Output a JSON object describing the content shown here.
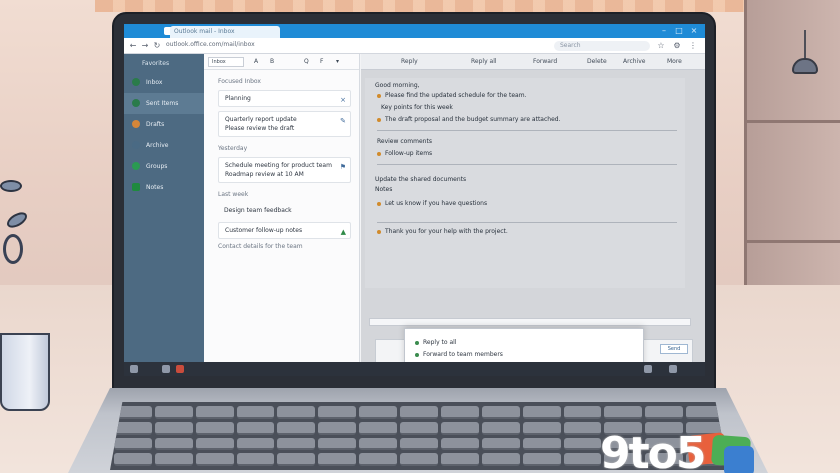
{
  "browser": {
    "tab_title": "Outlook mail - Inbox",
    "url": "outlook.office.com/mail/inbox",
    "search_placeholder": "Search",
    "back_icon": "arrow-left-icon",
    "forward_icon": "arrow-right-icon",
    "refresh_icon": "refresh-icon",
    "controls": [
      "–",
      "□",
      "×"
    ]
  },
  "sidebar": {
    "header": "Favorites",
    "items": [
      {
        "label": "Inbox",
        "color": "#2a7b4a"
      },
      {
        "label": "Sent Items",
        "color": "#2a7b4a"
      },
      {
        "label": "Drafts",
        "color": "#d4863a"
      },
      {
        "label": "Archive",
        "color": "#4a6a84"
      },
      {
        "label": "Groups",
        "color": "#2a9a52"
      },
      {
        "label": "Notes",
        "color": "#1f8a3e"
      }
    ]
  },
  "mail_list": {
    "search_value": "Inbox",
    "toolbar_buttons": [
      "A",
      "B",
      "Q",
      "F",
      "▾"
    ],
    "sections": [
      {
        "header": "Focused Inbox",
        "cards": [
          {
            "line1": "Planning",
            "line2": ""
          },
          {
            "line1": "Quarterly report update",
            "line2": "Please review the draft"
          }
        ]
      },
      {
        "header": "Yesterday",
        "cards": [
          {
            "line1": "Schedule meeting for product team",
            "line2": "Roadmap review at 10 AM"
          }
        ]
      },
      {
        "header": "Last week",
        "cards": [
          {
            "line1": "Design team feedback",
            "line2": ""
          },
          {
            "line1": "Customer follow-up notes",
            "line2": ""
          }
        ]
      }
    ],
    "footer": "Contact details for the team"
  },
  "reading": {
    "toolbar": [
      "Reply",
      "Reply all",
      "Forward",
      "Delete",
      "Archive",
      "More"
    ],
    "lines": [
      "Good morning,",
      "Please find the updated schedule for the team.",
      "Key points for this week",
      "The draft proposal and the budget summary are attached.",
      "Review comments",
      "Follow-up items",
      "Update the shared documents",
      "Notes",
      "Let us know if you have questions",
      "Thank you for your help with the project."
    ],
    "compose_send": "Send",
    "popup_lines": [
      "Reply to all",
      "Forward to team members"
    ]
  },
  "logo": {
    "text": "9to5",
    "colors": [
      "#e8603c",
      "#f0a23a",
      "#4cae55",
      "#3b7fd0"
    ]
  }
}
